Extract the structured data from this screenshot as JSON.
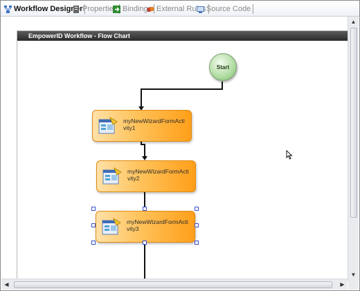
{
  "tabs": [
    {
      "label": "Workflow Designer",
      "icon": "workflow-icon",
      "active": true
    },
    {
      "label": "Properties",
      "icon": "properties-icon",
      "active": false
    },
    {
      "label": "Bindings",
      "icon": "bindings-icon",
      "active": false
    },
    {
      "label": "External Rules",
      "icon": "external-rules-icon",
      "active": false
    },
    {
      "label": "Source Code",
      "icon": "source-code-icon",
      "active": false
    }
  ],
  "panel": {
    "title": "EmpowerID Workflow - Flow Chart"
  },
  "start": {
    "label": "Start"
  },
  "activities": [
    {
      "label": "myNewWizardFormActivity1",
      "selected": false
    },
    {
      "label": "myNewWizardFormActivity2",
      "selected": false
    },
    {
      "label": "myNewWizardFormActivity3",
      "selected": true
    }
  ],
  "colors": {
    "accent": "#ff9f1a",
    "start": "#b5dfa7",
    "selection": "#3a4fc8"
  }
}
